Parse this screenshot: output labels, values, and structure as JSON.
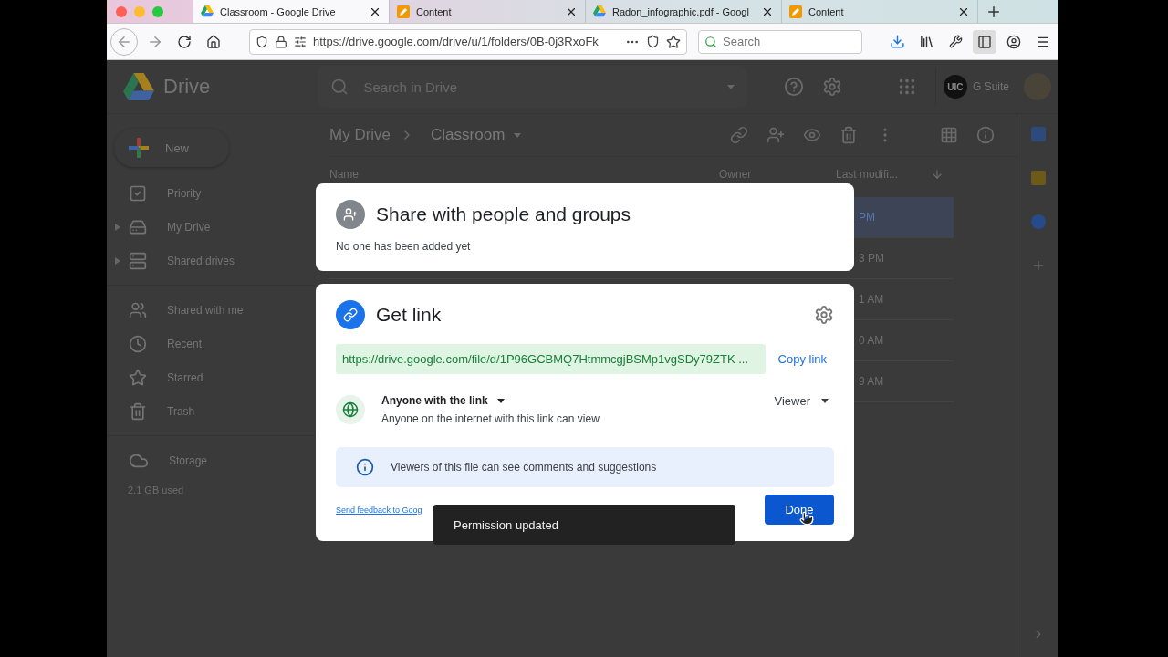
{
  "browser": {
    "tabs": [
      {
        "title": "Classroom - Google Drive",
        "kind": "drive",
        "selected": true
      },
      {
        "title": "Content",
        "kind": "slides",
        "selected": false
      },
      {
        "title": "Radon_infographic.pdf - Googl",
        "kind": "drive",
        "selected": false
      },
      {
        "title": "Content",
        "kind": "slides",
        "selected": false
      }
    ],
    "url": "https://drive.google.com/drive/u/1/folders/0B-0j3RxoFk",
    "search_placeholder": "Search",
    "sidebar_toggle": {
      "pressed": true
    }
  },
  "drive": {
    "app_name": "Drive",
    "search_placeholder": "Search in Drive",
    "org_badge": "UIC",
    "suite": "G Suite",
    "new_button": "New",
    "sidebar": {
      "items": [
        {
          "label": "Priority",
          "kind": "priority",
          "expandable": false,
          "group_start": false
        },
        {
          "label": "My Drive",
          "kind": "drive",
          "expandable": true,
          "group_start": false
        },
        {
          "label": "Shared drives",
          "kind": "shared",
          "expandable": true,
          "group_start": false
        },
        {
          "label": "Shared with me",
          "kind": "people",
          "expandable": false,
          "group_start": true
        },
        {
          "label": "Recent",
          "kind": "recent",
          "expandable": false,
          "group_start": false
        },
        {
          "label": "Starred",
          "kind": "starred",
          "expandable": false,
          "group_start": false
        },
        {
          "label": "Trash",
          "kind": "trash",
          "expandable": false,
          "group_start": false
        }
      ],
      "storage": {
        "label": "Storage",
        "usage": "2.1 GB used"
      }
    },
    "breadcrumb": [
      "My Drive",
      "Classroom"
    ],
    "table": {
      "columns": [
        "Name",
        "Owner",
        "Last modifi..."
      ],
      "rows": [
        {
          "modified": "PM",
          "selected": true
        },
        {
          "modified": "3 PM",
          "selected": false
        },
        {
          "modified": "1 AM",
          "selected": false
        },
        {
          "modified": "0 AM",
          "selected": false
        },
        {
          "modified": "9 AM",
          "selected": false
        }
      ]
    }
  },
  "share_dialog": {
    "people": {
      "title": "Share with people and groups",
      "subtitle": "No one has been added yet"
    },
    "link": {
      "title": "Get link",
      "url": "https://drive.google.com/file/d/1P96GCBMQ7HtmmcgjBSMp1vgSDy79ZTK ...",
      "copy": "Copy link",
      "access": "Anyone with the link",
      "access_note": "Anyone on the internet with this link can view",
      "role": "Viewer",
      "info": "Viewers of this file can see comments and suggestions",
      "feedback": "Send feedback to Goog",
      "done": "Done"
    }
  },
  "toast": "Permission updated"
}
